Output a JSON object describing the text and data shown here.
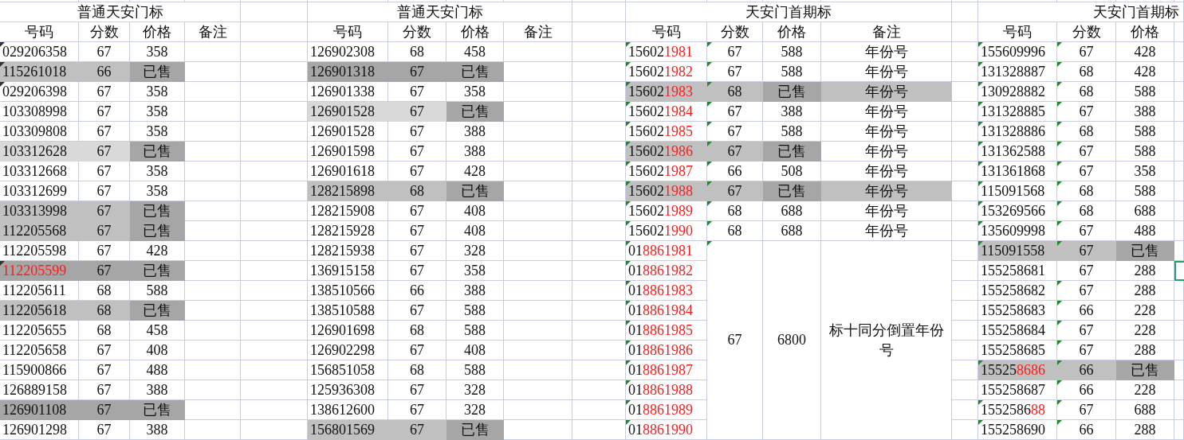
{
  "sections": [
    {
      "title": "普通天安门标",
      "title_cut": false,
      "kind": "ordinary",
      "headers": [
        "号码",
        "分数",
        "价格",
        "备注"
      ],
      "rows": [
        {
          "number": [
            {
              "text": "029206358",
              "red": false
            }
          ],
          "score": "67",
          "price": "358",
          "kind": "plain",
          "mark_number": true,
          "mark_score": false
        },
        {
          "number": [
            {
              "text": "115261018",
              "red": false
            }
          ],
          "score": "66",
          "price": "已售",
          "kind": "sold",
          "mark_number": true,
          "mark_score": false
        },
        {
          "number": [
            {
              "text": "029206398",
              "red": false
            }
          ],
          "score": "67",
          "price": "358",
          "kind": "plain",
          "mark_number": true,
          "mark_score": false
        },
        {
          "number": [
            {
              "text": "103308998",
              "red": false
            }
          ],
          "score": "67",
          "price": "358",
          "kind": "plain",
          "mark_number": false,
          "mark_score": false
        },
        {
          "number": [
            {
              "text": "103309808",
              "red": false
            }
          ],
          "score": "67",
          "price": "358",
          "kind": "plain",
          "mark_number": false,
          "mark_score": false
        },
        {
          "number": [
            {
              "text": "103312628",
              "red": false
            }
          ],
          "score": "67",
          "price": "已售",
          "kind": "pale",
          "mark_number": false,
          "mark_score": false
        },
        {
          "number": [
            {
              "text": "103312668",
              "red": false
            }
          ],
          "score": "67",
          "price": "358",
          "kind": "plain",
          "mark_number": false,
          "mark_score": false
        },
        {
          "number": [
            {
              "text": "103312699",
              "red": false
            }
          ],
          "score": "67",
          "price": "358",
          "kind": "plain",
          "mark_number": false,
          "mark_score": false
        },
        {
          "number": [
            {
              "text": "103313998",
              "red": false
            }
          ],
          "score": "67",
          "price": "已售",
          "kind": "sold",
          "mark_number": false,
          "mark_score": false
        },
        {
          "number": [
            {
              "text": "112205568",
              "red": false
            }
          ],
          "score": "67",
          "price": "已售",
          "kind": "sold",
          "mark_number": false,
          "mark_score": false
        },
        {
          "number": [
            {
              "text": "112205598",
              "red": false
            }
          ],
          "score": "67",
          "price": "428",
          "kind": "plain",
          "mark_number": false,
          "mark_score": false
        },
        {
          "number": [
            {
              "text": "112205599",
              "red": true
            }
          ],
          "score": "67",
          "price": "已售",
          "kind": "deep",
          "mark_number": true,
          "mark_score": false
        },
        {
          "number": [
            {
              "text": "112205611",
              "red": false
            }
          ],
          "score": "68",
          "price": "588",
          "kind": "plain",
          "mark_number": false,
          "mark_score": false
        },
        {
          "number": [
            {
              "text": "112205618",
              "red": false
            }
          ],
          "score": "68",
          "price": "已售",
          "kind": "sold",
          "mark_number": false,
          "mark_score": false
        },
        {
          "number": [
            {
              "text": "112205655",
              "red": false
            }
          ],
          "score": "68",
          "price": "458",
          "kind": "plain",
          "mark_number": false,
          "mark_score": false
        },
        {
          "number": [
            {
              "text": "112205658",
              "red": false
            }
          ],
          "score": "67",
          "price": "408",
          "kind": "plain",
          "mark_number": false,
          "mark_score": false
        },
        {
          "number": [
            {
              "text": "115900866",
              "red": false
            }
          ],
          "score": "67",
          "price": "488",
          "kind": "plain",
          "mark_number": false,
          "mark_score": false
        },
        {
          "number": [
            {
              "text": "126889158",
              "red": false
            }
          ],
          "score": "67",
          "price": "388",
          "kind": "plain",
          "mark_number": false,
          "mark_score": false
        },
        {
          "number": [
            {
              "text": "126901108",
              "red": false
            }
          ],
          "score": "67",
          "price": "已售",
          "kind": "deep",
          "mark_number": false,
          "mark_score": false
        },
        {
          "number": [
            {
              "text": "126901298",
              "red": false
            }
          ],
          "score": "67",
          "price": "388",
          "kind": "plain",
          "mark_number": false,
          "mark_score": false
        }
      ]
    },
    {
      "title": "普通天安门标",
      "title_cut": false,
      "kind": "ordinary",
      "headers": [
        "号码",
        "分数",
        "价格",
        "备注"
      ],
      "rows": [
        {
          "number": [
            {
              "text": "126902308",
              "red": false
            }
          ],
          "score": "68",
          "price": "458",
          "kind": "plain",
          "mark_number": false,
          "mark_score": false
        },
        {
          "number": [
            {
              "text": "126901318",
              "red": false
            }
          ],
          "score": "67",
          "price": "已售",
          "kind": "deep",
          "mark_number": false,
          "mark_score": false
        },
        {
          "number": [
            {
              "text": "126901338",
              "red": false
            }
          ],
          "score": "67",
          "price": "358",
          "kind": "plain",
          "mark_number": false,
          "mark_score": false
        },
        {
          "number": [
            {
              "text": "126901528",
              "red": false
            }
          ],
          "score": "67",
          "price": "已售",
          "kind": "pale",
          "mark_number": false,
          "mark_score": false
        },
        {
          "number": [
            {
              "text": "126901528",
              "red": false
            }
          ],
          "score": "67",
          "price": "388",
          "kind": "plain",
          "mark_number": false,
          "mark_score": false
        },
        {
          "number": [
            {
              "text": "126901598",
              "red": false
            }
          ],
          "score": "67",
          "price": "388",
          "kind": "plain",
          "mark_number": false,
          "mark_score": false
        },
        {
          "number": [
            {
              "text": "126901618",
              "red": false
            }
          ],
          "score": "67",
          "price": "428",
          "kind": "plain",
          "mark_number": false,
          "mark_score": false
        },
        {
          "number": [
            {
              "text": "128215898",
              "red": false
            }
          ],
          "score": "68",
          "price": "已售",
          "kind": "sold",
          "mark_number": false,
          "mark_score": false
        },
        {
          "number": [
            {
              "text": "128215908",
              "red": false
            }
          ],
          "score": "67",
          "price": "408",
          "kind": "plain",
          "mark_number": false,
          "mark_score": false
        },
        {
          "number": [
            {
              "text": "128215928",
              "red": false
            }
          ],
          "score": "67",
          "price": "408",
          "kind": "plain",
          "mark_number": false,
          "mark_score": false
        },
        {
          "number": [
            {
              "text": "128215938",
              "red": false
            }
          ],
          "score": "67",
          "price": "328",
          "kind": "plain",
          "mark_number": false,
          "mark_score": false
        },
        {
          "number": [
            {
              "text": "136915158",
              "red": false
            }
          ],
          "score": "67",
          "price": "358",
          "kind": "plain",
          "mark_number": false,
          "mark_score": false
        },
        {
          "number": [
            {
              "text": "138510566",
              "red": false
            }
          ],
          "score": "66",
          "price": "388",
          "kind": "plain",
          "mark_number": false,
          "mark_score": false
        },
        {
          "number": [
            {
              "text": "138510588",
              "red": false
            }
          ],
          "score": "67",
          "price": "588",
          "kind": "plain",
          "mark_number": false,
          "mark_score": false
        },
        {
          "number": [
            {
              "text": "126901698",
              "red": false
            }
          ],
          "score": "68",
          "price": "588",
          "kind": "plain",
          "mark_number": false,
          "mark_score": false
        },
        {
          "number": [
            {
              "text": "126902298",
              "red": false
            }
          ],
          "score": "67",
          "price": "408",
          "kind": "plain",
          "mark_number": false,
          "mark_score": false
        },
        {
          "number": [
            {
              "text": "156851058",
              "red": false
            }
          ],
          "score": "68",
          "price": "588",
          "kind": "plain",
          "mark_number": false,
          "mark_score": false
        },
        {
          "number": [
            {
              "text": "125936308",
              "red": false
            }
          ],
          "score": "67",
          "price": "328",
          "kind": "plain",
          "mark_number": false,
          "mark_score": false
        },
        {
          "number": [
            {
              "text": "138612600",
              "red": false
            }
          ],
          "score": "67",
          "price": "328",
          "kind": "plain",
          "mark_number": false,
          "mark_score": false
        },
        {
          "number": [
            {
              "text": "156801569",
              "red": false
            }
          ],
          "score": "67",
          "price": "已售",
          "kind": "sold",
          "mark_number": false,
          "mark_score": false
        }
      ]
    },
    {
      "title": "天安门首期标",
      "title_cut": false,
      "kind": "checked",
      "headers": [
        "号码",
        "分数",
        "价格",
        "备注"
      ],
      "rows": [
        {
          "number": [
            {
              "text": "15602",
              "red": false
            },
            {
              "text": "1981",
              "red": true
            }
          ],
          "score": "67",
          "price": "588",
          "note": "年份号",
          "kind": "plain",
          "note_highlighted": false,
          "mark_number": true,
          "mark_score": true
        },
        {
          "number": [
            {
              "text": "15602",
              "red": false
            },
            {
              "text": "1982",
              "red": true
            }
          ],
          "score": "67",
          "price": "588",
          "note": "年份号",
          "kind": "plain",
          "note_highlighted": false,
          "mark_number": true,
          "mark_score": true
        },
        {
          "number": [
            {
              "text": "15602",
              "red": false
            },
            {
              "text": "1983",
              "red": true
            }
          ],
          "score": "68",
          "price": "已售",
          "note": "年份号",
          "kind": "sold",
          "note_highlighted": true,
          "mark_number": true,
          "mark_score": true
        },
        {
          "number": [
            {
              "text": "15602",
              "red": false
            },
            {
              "text": "1984",
              "red": true
            }
          ],
          "score": "67",
          "price": "388",
          "note": "年份号",
          "kind": "plain",
          "note_highlighted": false,
          "mark_number": true,
          "mark_score": true
        },
        {
          "number": [
            {
              "text": "15602",
              "red": false
            },
            {
              "text": "1985",
              "red": true
            }
          ],
          "score": "67",
          "price": "588",
          "note": "年份号",
          "kind": "plain",
          "note_highlighted": false,
          "mark_number": true,
          "mark_score": true
        },
        {
          "number": [
            {
              "text": "15602",
              "red": false
            },
            {
              "text": "1986",
              "red": true
            }
          ],
          "score": "67",
          "price": "已售",
          "note": "年份号",
          "kind": "sold",
          "note_highlighted": false,
          "mark_number": true,
          "mark_score": true
        },
        {
          "number": [
            {
              "text": "15602",
              "red": false
            },
            {
              "text": "1987",
              "red": true
            }
          ],
          "score": "66",
          "price": "508",
          "note": "年份号",
          "kind": "plain",
          "note_highlighted": false,
          "mark_number": true,
          "mark_score": true
        },
        {
          "number": [
            {
              "text": "15602",
              "red": false
            },
            {
              "text": "1988",
              "red": true
            }
          ],
          "score": "67",
          "price": "已售",
          "note": "年份号",
          "kind": "sold",
          "note_highlighted": true,
          "mark_number": true,
          "mark_score": true
        },
        {
          "number": [
            {
              "text": "15602",
              "red": false
            },
            {
              "text": "1989",
              "red": true
            }
          ],
          "score": "68",
          "price": "688",
          "note": "年份号",
          "kind": "plain",
          "note_highlighted": false,
          "mark_number": true,
          "mark_score": true
        },
        {
          "number": [
            {
              "text": "15602",
              "red": false
            },
            {
              "text": "1990",
              "red": true
            }
          ],
          "score": "68",
          "price": "688",
          "note": "年份号",
          "kind": "plain",
          "note_highlighted": false,
          "mark_number": true,
          "mark_score": true
        }
      ],
      "group": {
        "score": "67",
        "price": "6800",
        "note": "标十同分倒置年份号",
        "mark_score": true,
        "numbers": [
          {
            "number": [
              {
                "text": "01",
                "red": false
              },
              {
                "text": "8861981",
                "red": true
              }
            ],
            "mark_number": true
          },
          {
            "number": [
              {
                "text": "01",
                "red": false
              },
              {
                "text": "8861982",
                "red": true
              }
            ],
            "mark_number": true
          },
          {
            "number": [
              {
                "text": "01",
                "red": false
              },
              {
                "text": "8861983",
                "red": true
              }
            ],
            "mark_number": true
          },
          {
            "number": [
              {
                "text": "01",
                "red": false
              },
              {
                "text": "8861984",
                "red": true
              }
            ],
            "mark_number": true
          },
          {
            "number": [
              {
                "text": "01",
                "red": false
              },
              {
                "text": "8861985",
                "red": true
              }
            ],
            "mark_number": true
          },
          {
            "number": [
              {
                "text": "01",
                "red": false
              },
              {
                "text": "8861986",
                "red": true
              }
            ],
            "mark_number": true
          },
          {
            "number": [
              {
                "text": "01",
                "red": false
              },
              {
                "text": "8861987",
                "red": true
              }
            ],
            "mark_number": true
          },
          {
            "number": [
              {
                "text": "01",
                "red": false
              },
              {
                "text": "8861988",
                "red": true
              }
            ],
            "mark_number": true
          },
          {
            "number": [
              {
                "text": "01",
                "red": false
              },
              {
                "text": "8861989",
                "red": true
              }
            ],
            "mark_number": true
          },
          {
            "number": [
              {
                "text": "01",
                "red": false
              },
              {
                "text": "8861990",
                "red": true
              }
            ],
            "mark_number": true
          }
        ]
      }
    },
    {
      "title": "天安门首期标",
      "title_cut": true,
      "kind": "checked",
      "headers": [
        "号码",
        "分数",
        "价格"
      ],
      "rows": [
        {
          "number": [
            {
              "text": "155609996",
              "red": false
            }
          ],
          "score": "67",
          "price": "428",
          "kind": "plain",
          "mark_number": true,
          "mark_score": true,
          "selected": false
        },
        {
          "number": [
            {
              "text": "131328887",
              "red": false
            }
          ],
          "score": "68",
          "price": "428",
          "kind": "plain",
          "mark_number": true,
          "mark_score": true,
          "selected": false
        },
        {
          "number": [
            {
              "text": "130928882",
              "red": false
            }
          ],
          "score": "68",
          "price": "588",
          "kind": "plain",
          "mark_number": true,
          "mark_score": true,
          "selected": false
        },
        {
          "number": [
            {
              "text": "131328885",
              "red": false
            }
          ],
          "score": "67",
          "price": "388",
          "kind": "plain",
          "mark_number": true,
          "mark_score": true,
          "selected": false
        },
        {
          "number": [
            {
              "text": "131328886",
              "red": false
            }
          ],
          "score": "68",
          "price": "588",
          "kind": "plain",
          "mark_number": true,
          "mark_score": true,
          "selected": false
        },
        {
          "number": [
            {
              "text": "131362588",
              "red": false
            }
          ],
          "score": "67",
          "price": "588",
          "kind": "plain",
          "mark_number": true,
          "mark_score": true,
          "selected": false
        },
        {
          "number": [
            {
              "text": "131361868",
              "red": false
            }
          ],
          "score": "67",
          "price": "358",
          "kind": "plain",
          "mark_number": true,
          "mark_score": true,
          "selected": false
        },
        {
          "number": [
            {
              "text": "115091568",
              "red": false
            }
          ],
          "score": "68",
          "price": "588",
          "kind": "plain",
          "mark_number": true,
          "mark_score": true,
          "selected": false
        },
        {
          "number": [
            {
              "text": "153269566",
              "red": false
            }
          ],
          "score": "68",
          "price": "688",
          "kind": "plain",
          "mark_number": true,
          "mark_score": true,
          "selected": false
        },
        {
          "number": [
            {
              "text": "135609998",
              "red": false
            }
          ],
          "score": "67",
          "price": "488",
          "kind": "plain",
          "mark_number": true,
          "mark_score": true,
          "selected": false
        },
        {
          "number": [
            {
              "text": "115091558",
              "red": false
            }
          ],
          "score": "67",
          "price": "已售",
          "kind": "sold",
          "mark_number": true,
          "mark_score": true,
          "selected": false
        },
        {
          "number": [
            {
              "text": "155258681",
              "red": false
            }
          ],
          "score": "67",
          "price": "288",
          "kind": "plain",
          "mark_number": false,
          "mark_score": false,
          "selected": true
        },
        {
          "number": [
            {
              "text": "155258682",
              "red": false
            }
          ],
          "score": "67",
          "price": "288",
          "kind": "plain",
          "mark_number": false,
          "mark_score": true,
          "selected": false
        },
        {
          "number": [
            {
              "text": "155258683",
              "red": false
            }
          ],
          "score": "66",
          "price": "228",
          "kind": "plain",
          "mark_number": false,
          "mark_score": true,
          "selected": false
        },
        {
          "number": [
            {
              "text": "155258684",
              "red": false
            }
          ],
          "score": "67",
          "price": "228",
          "kind": "plain",
          "mark_number": false,
          "mark_score": true,
          "selected": false
        },
        {
          "number": [
            {
              "text": "155258685",
              "red": false
            }
          ],
          "score": "67",
          "price": "288",
          "kind": "plain",
          "mark_number": false,
          "mark_score": true,
          "selected": false
        },
        {
          "number": [
            {
              "text": "15525",
              "red": false
            },
            {
              "text": "8686",
              "red": true
            }
          ],
          "score": "66",
          "price": "已售",
          "kind": "sold",
          "mark_number": true,
          "mark_score": true,
          "selected": false
        },
        {
          "number": [
            {
              "text": "155258687",
              "red": false
            }
          ],
          "score": "66",
          "price": "228",
          "kind": "plain",
          "mark_number": false,
          "mark_score": true,
          "selected": false
        },
        {
          "number": [
            {
              "text": "1552586",
              "red": false
            },
            {
              "text": "88",
              "red": true
            }
          ],
          "score": "67",
          "price": "688",
          "kind": "plain",
          "mark_number": true,
          "mark_score": true,
          "selected": false
        },
        {
          "number": [
            {
              "text": "155258690",
              "red": false
            }
          ],
          "score": "66",
          "price": "288",
          "kind": "plain",
          "mark_number": true,
          "mark_score": true,
          "selected": false
        }
      ]
    }
  ]
}
